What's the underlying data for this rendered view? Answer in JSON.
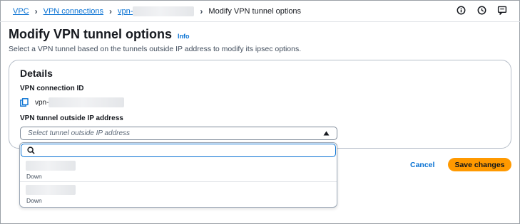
{
  "breadcrumb": {
    "items": [
      {
        "label": "VPC"
      },
      {
        "label": "VPN connections"
      },
      {
        "label": "vpn-"
      }
    ],
    "current": "Modify VPN tunnel options"
  },
  "toolbar": {
    "icons": [
      "info-icon",
      "history-icon",
      "feedback-icon"
    ]
  },
  "page": {
    "title": "Modify VPN tunnel options",
    "info_link": "Info",
    "description": "Select a VPN tunnel based on the tunnels outside IP address to modify its ipsec options."
  },
  "details": {
    "title": "Details",
    "connection_id_label": "VPN connection ID",
    "connection_id_value": "vpn-",
    "tunnel_ip_label": "VPN tunnel outside IP address",
    "select_placeholder": "Select tunnel outside IP address"
  },
  "dropdown": {
    "search_value": "",
    "options": [
      {
        "status": "Down"
      },
      {
        "status": "Down"
      }
    ]
  },
  "actions": {
    "cancel_label": "Cancel",
    "save_label": "Save changes"
  },
  "colors": {
    "link": "#0972d3",
    "primary_button": "#ff9900",
    "text": "#16191f"
  }
}
